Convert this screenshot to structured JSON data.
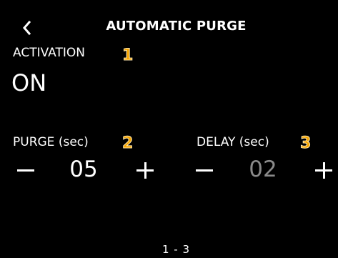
{
  "header": {
    "title": "AUTOMATIC PURGE",
    "back_icon": "chevron-left-icon"
  },
  "activation": {
    "label": "ACTIVATION",
    "badge": "1",
    "value": "ON"
  },
  "purge": {
    "label": "PURGE (sec)",
    "badge": "2",
    "decrement": "minus-icon",
    "value": "05",
    "increment": "plus-icon"
  },
  "delay": {
    "label": "DELAY (sec)",
    "badge": "3",
    "decrement": "minus-icon",
    "value": "02",
    "increment": "plus-icon"
  },
  "pager": "1 - 3",
  "colors": {
    "background": "#000000",
    "text": "#ffffff",
    "disabled_value": "#8a8a8a",
    "badge": "#f5a400"
  }
}
